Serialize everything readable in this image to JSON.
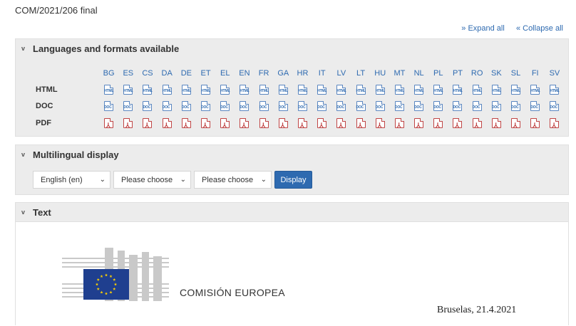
{
  "doc_id": "COM/2021/206 final",
  "controls": {
    "expand_all": "Expand all",
    "collapse_all": "Collapse all"
  },
  "panels": {
    "languages": {
      "title": "Languages and formats available"
    },
    "multilingual": {
      "title": "Multilingual display"
    },
    "text": {
      "title": "Text"
    }
  },
  "languages": [
    "BG",
    "ES",
    "CS",
    "DA",
    "DE",
    "ET",
    "EL",
    "EN",
    "FR",
    "GA",
    "HR",
    "IT",
    "LV",
    "LT",
    "HU",
    "MT",
    "NL",
    "PL",
    "PT",
    "RO",
    "SK",
    "SL",
    "FI",
    "SV"
  ],
  "formats": [
    {
      "label": "HTML",
      "icon": "html-file-icon",
      "badge": "HTML"
    },
    {
      "label": "DOC",
      "icon": "doc-file-icon",
      "badge": "DOC"
    },
    {
      "label": "PDF",
      "icon": "pdf-file-icon",
      "badge": "⅄"
    }
  ],
  "multilingual": {
    "select1": "English (en)",
    "select2": "Please choose",
    "select3": "Please choose",
    "display_button": "Display"
  },
  "document": {
    "organization": "COMISIÓN EUROPEA",
    "place_date": "Bruselas, 21.4.2021"
  },
  "colors": {
    "link": "#2e6ab0",
    "panel_bg": "#ececec",
    "eu_blue": "#1f3f8f",
    "eu_star": "#ffd200",
    "pdf_red": "#c04545"
  }
}
